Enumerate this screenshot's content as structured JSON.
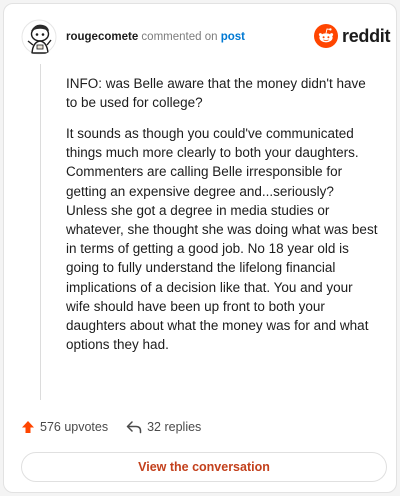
{
  "header": {
    "username": "rougecomete",
    "action_text": "commented on",
    "post_link": "post"
  },
  "brand": {
    "name": "reddit",
    "accent_color": "#ff4500"
  },
  "comment": {
    "paragraphs": [
      "INFO: was Belle aware that the money didn't have to be used for college?",
      "It sounds as though you could've communicated things much more clearly to both your daughters. Commenters are calling Belle irresponsible for getting an expensive degree and...seriously? Unless she got a degree in media studies or whatever, she thought she was doing what was best in terms of getting a good job. No 18 year old is going to fully understand the lifelong financial implications of a decision like that. You and your wife should have been up front to both your daughters about what the money was for and what options they had."
    ]
  },
  "stats": {
    "upvotes": "576 upvotes",
    "replies": "32 replies"
  },
  "footer": {
    "view_label": "View the conversation"
  },
  "icons": {
    "upvote": "upvote-arrow-icon",
    "reply": "reply-arrow-icon",
    "avatar": "snoo-avatar",
    "logo": "reddit-snoo-icon"
  }
}
